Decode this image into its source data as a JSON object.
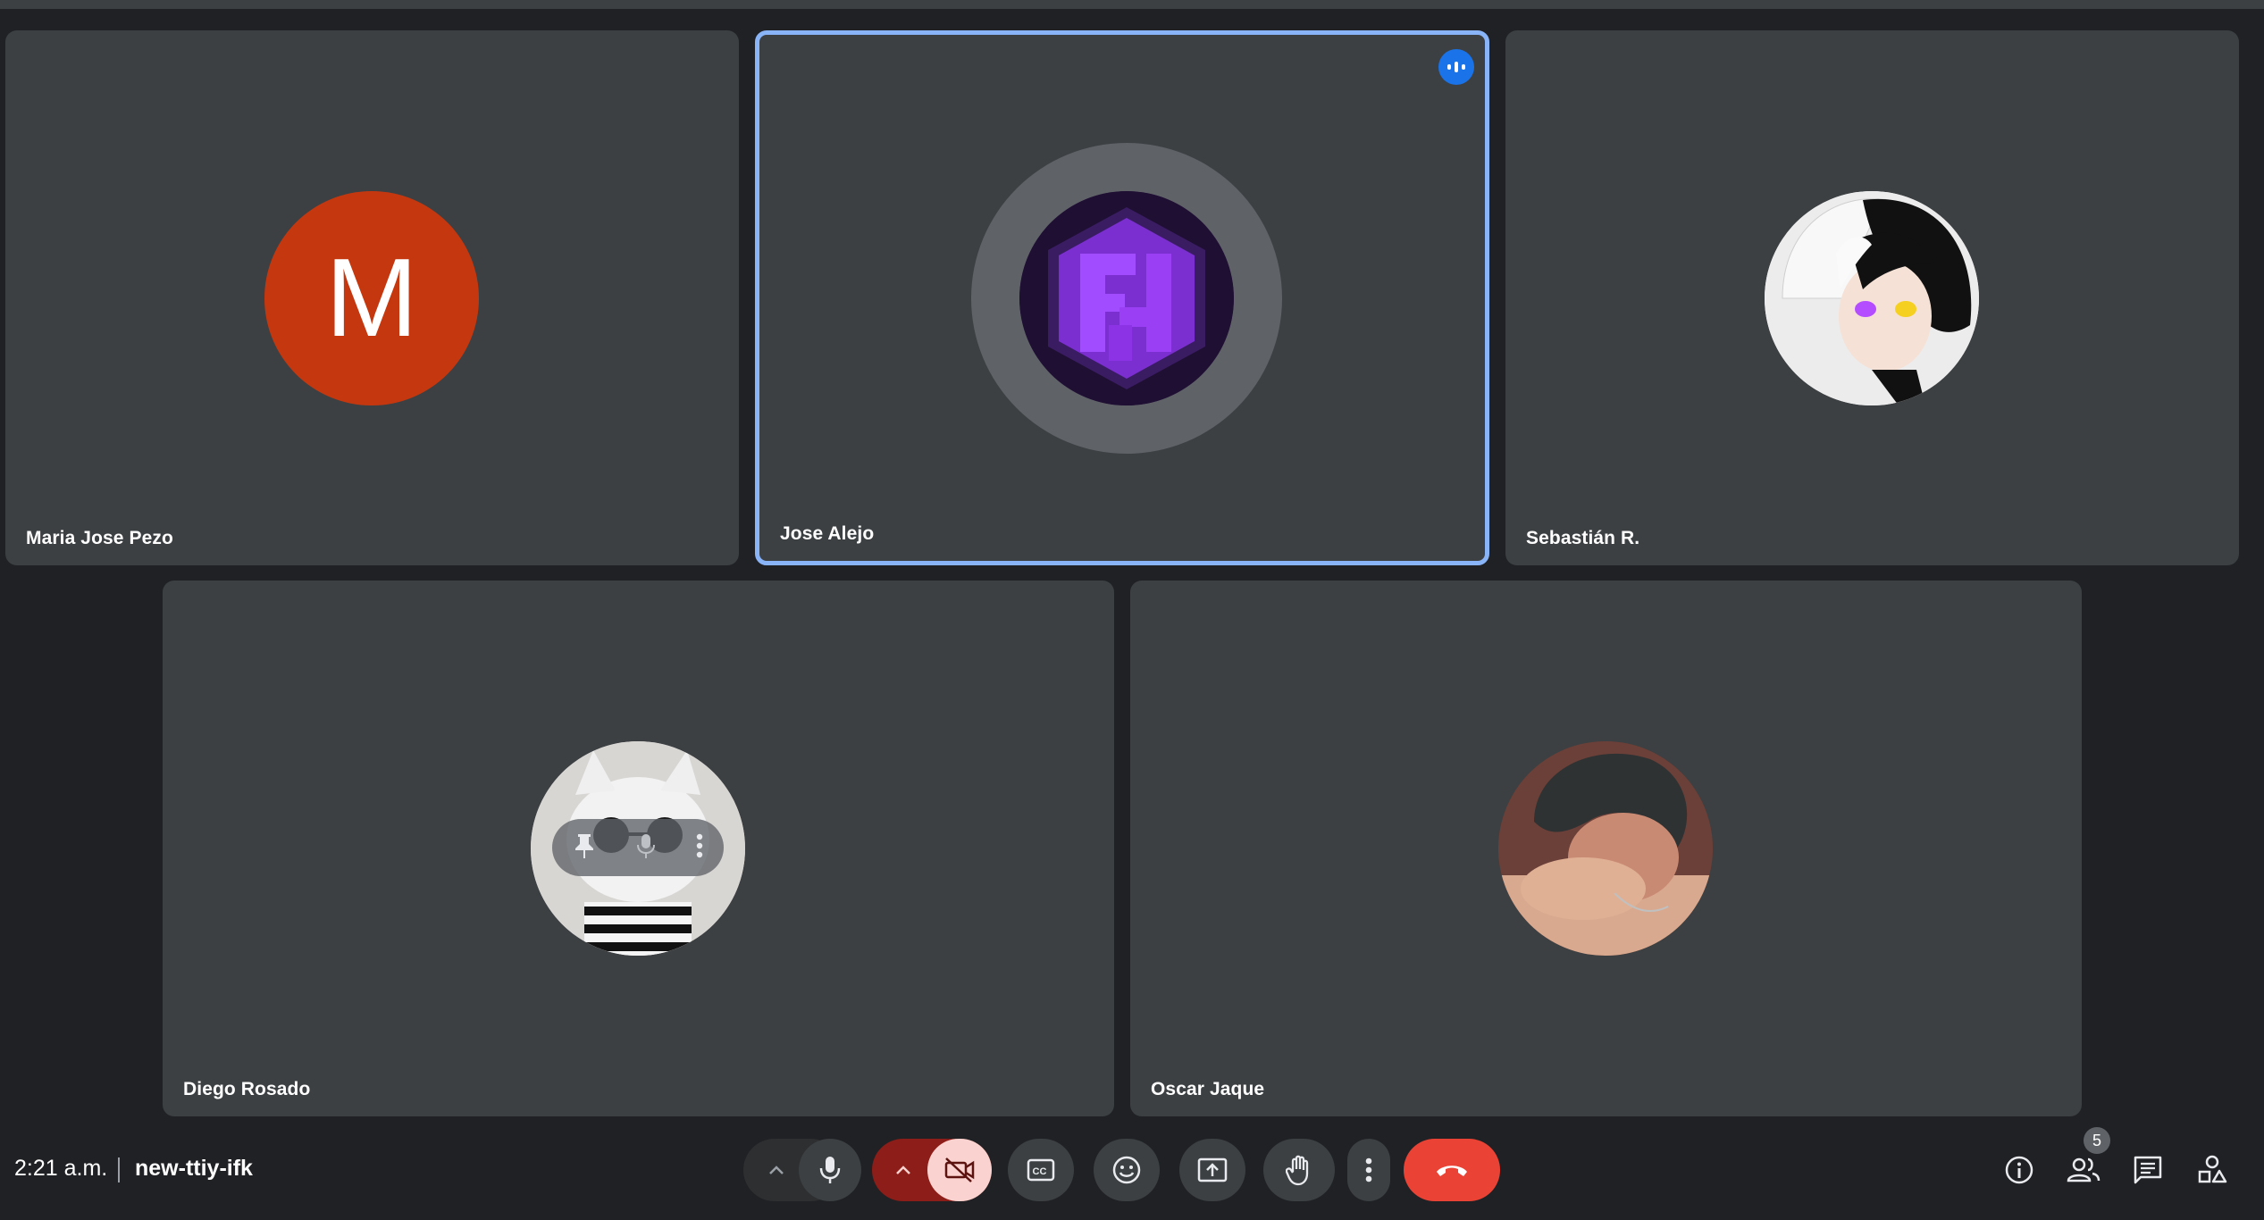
{
  "participants": [
    {
      "name": "Maria Jose Pezo",
      "avatar_type": "letter",
      "letter": "M",
      "avatar_color": "#c5380f"
    },
    {
      "name": "Jose Alejo",
      "avatar_type": "logo",
      "speaking": true
    },
    {
      "name": "Sebastián R.",
      "avatar_type": "anime-portrait"
    },
    {
      "name": "Diego Rosado",
      "avatar_type": "cat-photo",
      "hover_controls": [
        "pin-icon",
        "mic-off-icon",
        "more-vert-icon"
      ]
    },
    {
      "name": "Oscar Jaque",
      "avatar_type": "person-photo"
    }
  ],
  "meeting": {
    "time": "2:21 a.m.",
    "code": "new-ttiy-ifk"
  },
  "controls": [
    "chevron-up-icon",
    "mic-icon",
    "camera-off-icon",
    "captions-icon",
    "emoji-icon",
    "present-icon",
    "raise-hand-icon",
    "more-options-icon",
    "end-call-icon"
  ],
  "right_panel": {
    "participant_count": "5",
    "icons": [
      "info-icon",
      "people-icon",
      "chat-icon",
      "activities-icon"
    ]
  },
  "colors": {
    "background": "#202124",
    "tile": "#3c4043",
    "active_border": "#8ab4f8",
    "end_call": "#ea4335",
    "camera_off_bg": "#fad2cf",
    "camera_off_dark": "#8c1d18"
  }
}
